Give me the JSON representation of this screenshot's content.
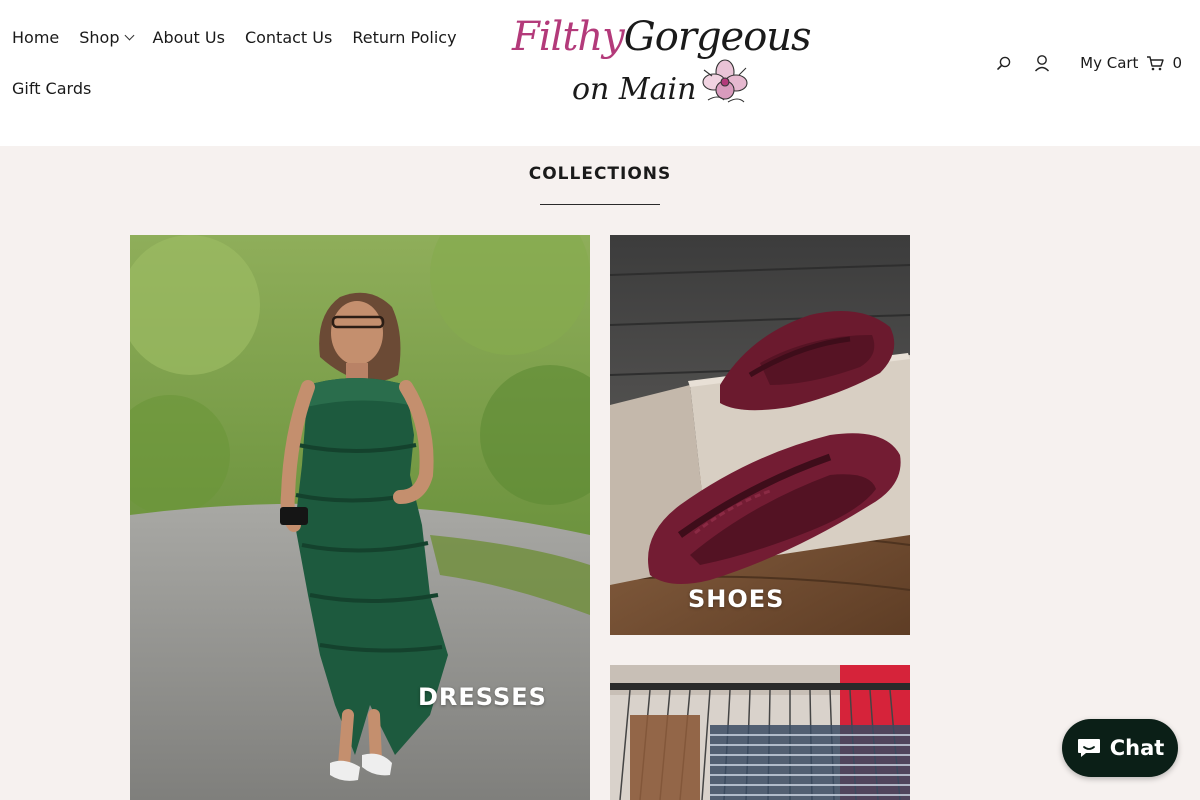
{
  "nav": {
    "row1": [
      {
        "label": "Home"
      },
      {
        "label": "Shop"
      },
      {
        "label": "About Us"
      },
      {
        "label": "Contact Us"
      },
      {
        "label": "Return Policy"
      }
    ],
    "row2": [
      {
        "label": "Gift Cards"
      }
    ]
  },
  "logo": {
    "word1": "Filthy",
    "word2": "Gorgeous",
    "line2": "on Main"
  },
  "cart": {
    "label": "My Cart",
    "count": "0"
  },
  "icons": {
    "search": "search-icon",
    "account": "user-icon",
    "cart": "shopping-cart-icon",
    "chat": "chat-bubble-icon"
  },
  "collections": {
    "title": "COLLECTIONS",
    "tiles": [
      {
        "label": "DRESSES"
      },
      {
        "label": "SHOES"
      },
      {
        "label": ""
      }
    ]
  },
  "chat": {
    "label": "Chat"
  },
  "colors": {
    "page_background": "#f6f1ef",
    "header_background": "#ffffff",
    "logo_accent": "#b33a7a",
    "chat_button": "#0b1f17"
  }
}
